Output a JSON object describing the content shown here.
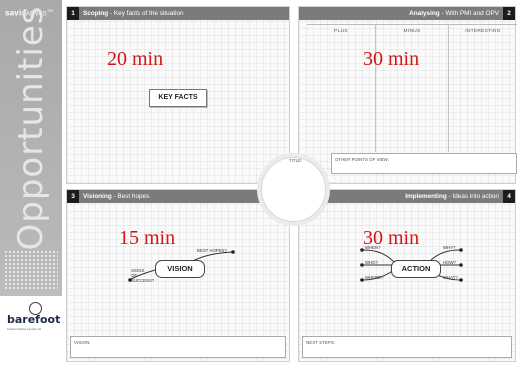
{
  "brand": {
    "main": "savi",
    "canvas": "CANVAS",
    "tm": "TM"
  },
  "sidebar": {
    "word": "Opportunities"
  },
  "logo": {
    "text": "barefoot",
    "tagline": "barefoot thinking company ltd"
  },
  "quadrants": {
    "scoping": {
      "number": "1",
      "title": "Scoping",
      "subtitle": " - Key facts of the situation",
      "timer": "20 min",
      "key_facts": "KEY FACTS"
    },
    "analysing": {
      "number": "2",
      "title": "Analysing",
      "subtitle": " - With PMI and OPV",
      "timer": "30 min",
      "columns": [
        "PLUS",
        "MINUS",
        "INTERESTING"
      ],
      "opv_label": "OTHER POINTS OF VIEW:"
    },
    "visioning": {
      "number": "3",
      "title": "Visioning",
      "subtitle": " - Best hopes",
      "timer": "15 min",
      "center": "VISION",
      "best_hopes": "BEST HOPES?",
      "signs": [
        "SIGNS",
        "OF",
        "SUCCESS?"
      ],
      "bottom_label": "VISION:"
    },
    "implementing": {
      "number": "4",
      "title": "Implementing",
      "subtitle": " - Ideas into action",
      "timer": "30 min",
      "center": "ACTION",
      "when": "WHEN?",
      "who": "WHO?",
      "how": "HOW?",
      "why": "WHY?",
      "where": "WHERE?",
      "what": "WHAT?",
      "bottom_label": "NEXT STEPS:"
    }
  },
  "title_label": "TITLE:"
}
